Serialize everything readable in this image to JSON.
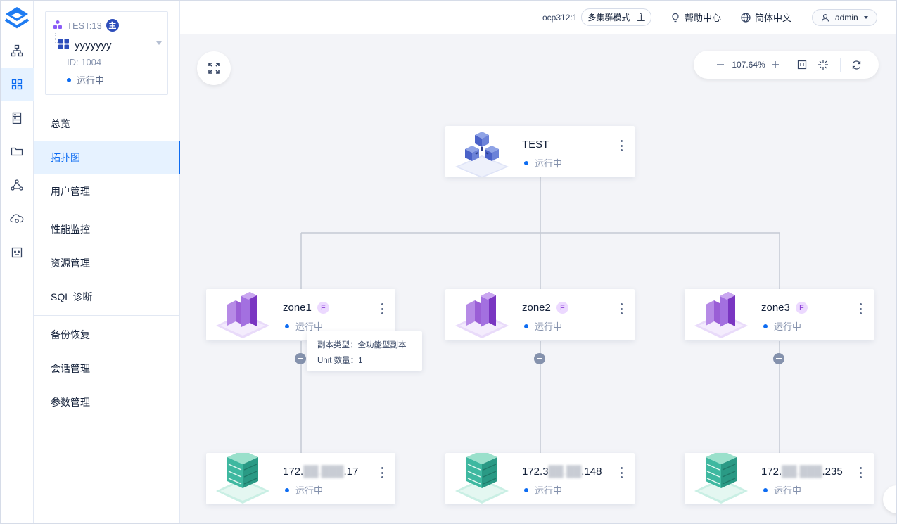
{
  "colors": {
    "accent": "#0d6cf2",
    "status_running": "#0d6cf2",
    "zone_purple": "#8b3fd6",
    "server_green": "#3eb8a0",
    "cluster_blue": "#4a62c8",
    "canvas_bg": "#f3f4f8"
  },
  "rail": {
    "items": [
      {
        "icon": "cluster-tree-icon"
      },
      {
        "icon": "grid-icon",
        "active": true
      },
      {
        "icon": "server-icon"
      },
      {
        "icon": "folder-icon"
      },
      {
        "icon": "nodes-icon"
      },
      {
        "icon": "cloud-icon"
      },
      {
        "icon": "robot-icon"
      }
    ]
  },
  "sidebar": {
    "cluster": {
      "tenant": "TEST:13",
      "badge": "主",
      "name": "yyyyyyy",
      "id": "ID: 1004",
      "status": "运行中"
    },
    "menu": {
      "overview": "总览",
      "topology": "拓扑图",
      "users": "用户管理",
      "performance": "性能监控",
      "resources": "资源管理",
      "sql": "SQL 诊断",
      "backup": "备份恢复",
      "sessions": "会话管理",
      "params": "参数管理"
    }
  },
  "header": {
    "cluster_label": "ocp312:1",
    "mode": "多集群模式",
    "mode_badge": "主",
    "help": "帮助中心",
    "language": "简体中文",
    "user": "admin"
  },
  "toolbar": {
    "zoom": "107.64%",
    "icons": [
      "zoom-out-icon",
      "zoom-in-icon",
      "fit-view-icon",
      "center-icon",
      "refresh-icon"
    ]
  },
  "topology": {
    "root": {
      "name": "TEST",
      "status": "运行中"
    },
    "zones": [
      {
        "name": "zone1",
        "badge": "F",
        "status": "运行中",
        "server": {
          "ip_prefix": "172.",
          "ip_masked": "██.███",
          "ip_suffix": ".17",
          "status": "运行中"
        }
      },
      {
        "name": "zone2",
        "badge": "F",
        "status": "运行中",
        "server": {
          "ip_prefix": "172.3",
          "ip_masked": "██.██",
          "ip_suffix": ".148",
          "status": "运行中"
        }
      },
      {
        "name": "zone3",
        "badge": "F",
        "status": "运行中",
        "server": {
          "ip_prefix": "172.",
          "ip_masked": "██.███",
          "ip_suffix": ".235",
          "status": "运行中"
        }
      }
    ],
    "tooltip": {
      "replica_type": "副本类型：全功能型副本",
      "unit_count": "Unit 数量：1"
    }
  }
}
